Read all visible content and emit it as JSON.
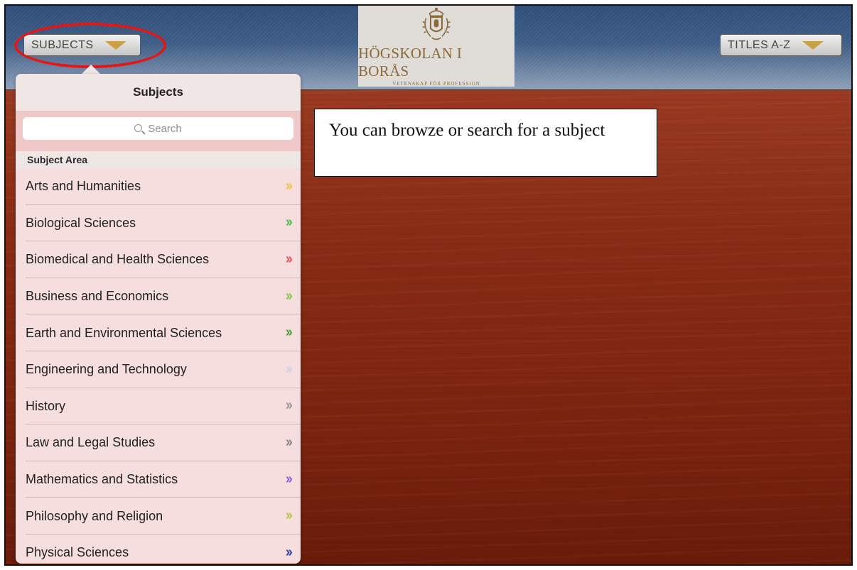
{
  "header": {
    "subjects_button": "SUBJECTS",
    "titles_button": "TITLES A-Z",
    "logo": {
      "name": "HÖGSKOLAN I BORÅS",
      "tagline": "VETENSKAP FÖR PROFESSION"
    }
  },
  "popover": {
    "title": "Subjects",
    "search_placeholder": "Search",
    "section_header": "Subject Area",
    "items": [
      {
        "label": "Arts and Humanities",
        "chevron_color": "#e8c94a"
      },
      {
        "label": "Biological Sciences",
        "chevron_color": "#5cb85c"
      },
      {
        "label": "Biomedical and Health Sciences",
        "chevron_color": "#e05a5a"
      },
      {
        "label": "Business and Economics",
        "chevron_color": "#8fc25a"
      },
      {
        "label": "Earth and Environmental Sciences",
        "chevron_color": "#4aa84a"
      },
      {
        "label": "Engineering and Technology",
        "chevron_color": "#c8d2e8"
      },
      {
        "label": "History",
        "chevron_color": "#9a9a9a"
      },
      {
        "label": "Law and Legal Studies",
        "chevron_color": "#8a8a8a"
      },
      {
        "label": "Mathematics and Statistics",
        "chevron_color": "#8a6ad0"
      },
      {
        "label": "Philosophy and Religion",
        "chevron_color": "#b8c84a"
      },
      {
        "label": "Physical Sciences",
        "chevron_color": "#3a4aa8"
      }
    ]
  },
  "callout": {
    "text": "You can browze or search for a subject"
  },
  "colors": {
    "highlight_ring": "#e01818",
    "caret": "#c9a142",
    "logo_text": "#8a6a3a"
  }
}
